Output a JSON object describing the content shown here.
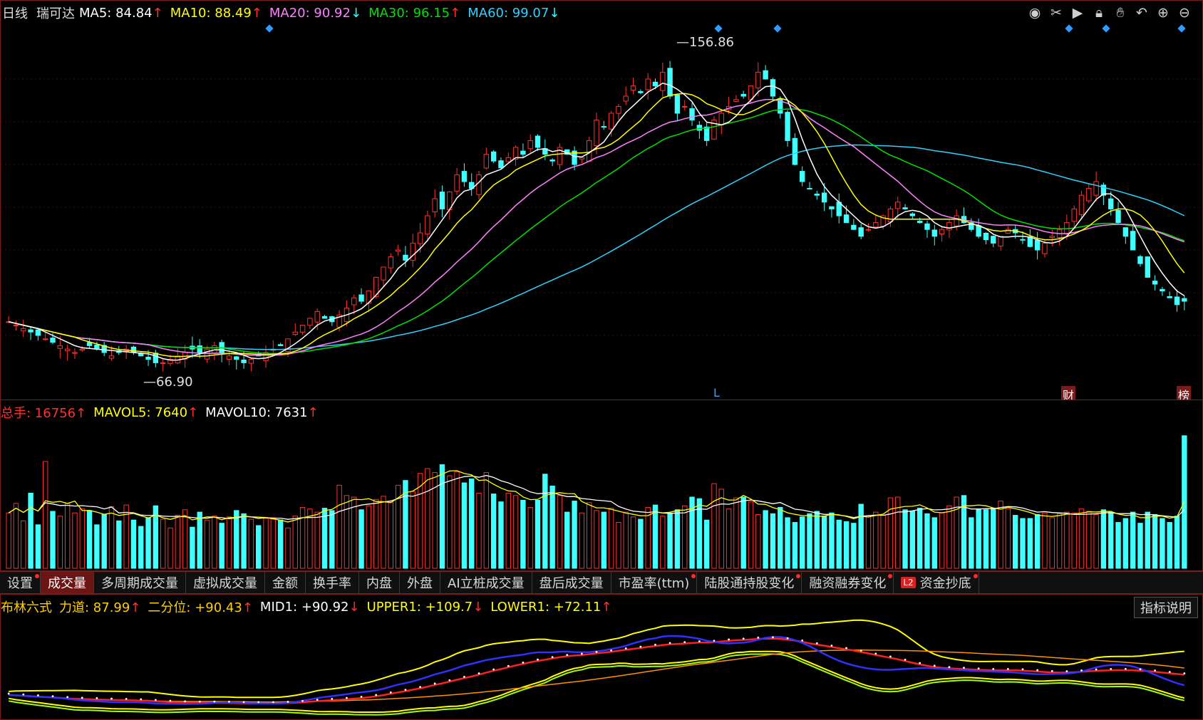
{
  "price_header": {
    "period": "日线",
    "stock": "瑞可达",
    "ma": [
      {
        "label": "MA5: 84.84",
        "arrow": "↑",
        "color": "#ffffff",
        "arrow_color": "#ff3030"
      },
      {
        "label": "MA10: 88.49",
        "arrow": "↑",
        "color": "#ffff00",
        "arrow_color": "#ff3030"
      },
      {
        "label": "MA20: 90.92",
        "arrow": "↓",
        "color": "#ff80ff",
        "arrow_color": "#20ffff"
      },
      {
        "label": "MA30: 96.15",
        "arrow": "↑",
        "color": "#00e000",
        "arrow_color": "#ff3030"
      },
      {
        "label": "MA60: 99.07",
        "arrow": "↓",
        "color": "#30d0ff",
        "arrow_color": "#20ffff"
      }
    ]
  },
  "toolbar_icons": [
    "eye-icon",
    "scissors-icon",
    "play-icon",
    "lock-icon",
    "hand-icon",
    "undo-icon",
    "zoom-in-icon",
    "zoom-out-icon"
  ],
  "price_labels": {
    "high": "156.86",
    "low": "66.90"
  },
  "markers": {
    "l_mark": "L",
    "finance_mark": "财",
    "rank_mark": "榜"
  },
  "volume_header": {
    "items": [
      {
        "label": "总手: 16756",
        "arrow": "↑",
        "color": "#ff3030"
      },
      {
        "label": "MAVOL5: 7640",
        "arrow": "↑",
        "color": "#ffff00"
      },
      {
        "label": "MAVOL10: 7631",
        "arrow": "↑",
        "color": "#ffffff"
      }
    ]
  },
  "tabs": [
    {
      "label": "设置",
      "dot": true,
      "active": false
    },
    {
      "label": "成交量",
      "dot": false,
      "active": true
    },
    {
      "label": "多周期成交量",
      "dot": false,
      "active": false
    },
    {
      "label": "虚拟成交量",
      "dot": false,
      "active": false
    },
    {
      "label": "金额",
      "dot": false,
      "active": false
    },
    {
      "label": "换手率",
      "dot": false,
      "active": false
    },
    {
      "label": "内盘",
      "dot": false,
      "active": false
    },
    {
      "label": "外盘",
      "dot": false,
      "active": false
    },
    {
      "label": "AI立桩成交量",
      "dot": false,
      "active": false
    },
    {
      "label": "盘后成交量",
      "dot": false,
      "active": false
    },
    {
      "label": "市盈率(ttm)",
      "dot": true,
      "active": false
    },
    {
      "label": "陆股通持股变化",
      "dot": true,
      "active": false
    },
    {
      "label": "融资融券变化",
      "dot": true,
      "active": false
    },
    {
      "label": "资金抄底",
      "dot": true,
      "active": false,
      "badge": "L2"
    }
  ],
  "indicator_header": {
    "items": [
      {
        "label": "布林六式",
        "arrow": "",
        "color": "#ffd000"
      },
      {
        "label": "力道: 87.99",
        "arrow": "↑",
        "color": "#ffd000"
      },
      {
        "label": "二分位: +90.43",
        "arrow": "↑",
        "color": "#ffd000"
      },
      {
        "label": "MID1: +90.92",
        "arrow": "↓",
        "color": "#ffffff"
      },
      {
        "label": "UPPER1: +109.7",
        "arrow": "↓",
        "color": "#ffff00"
      },
      {
        "label": "LOWER1: +72.11",
        "arrow": "↑",
        "color": "#ffff00"
      }
    ],
    "help_label": "指标说明"
  },
  "chart_data": {
    "type": "candlestick",
    "series_colors": {
      "up": "#ff3030",
      "down": "#40ffff",
      "ma5": "#ffffff",
      "ma10": "#ffff00",
      "ma20": "#ff80ff",
      "ma30": "#00e000",
      "ma60": "#30d0ff"
    },
    "y_range": [
      60,
      165
    ],
    "close": [
      79,
      78,
      77,
      76,
      75,
      74,
      73,
      72,
      71,
      70,
      71,
      72,
      71,
      70,
      69,
      70,
      71,
      70,
      69,
      68,
      67,
      67,
      68,
      69,
      70,
      71,
      70,
      71,
      72,
      70,
      69,
      68,
      67,
      68,
      69,
      70,
      71,
      72,
      74,
      76,
      78,
      80,
      82,
      80,
      79,
      81,
      83,
      86,
      85,
      88,
      92,
      95,
      98,
      100,
      97,
      102,
      105,
      110,
      115,
      112,
      117,
      122,
      120,
      118,
      122,
      128,
      126,
      124,
      127,
      130,
      128,
      132,
      130,
      128,
      126,
      130,
      128,
      125,
      127,
      132,
      138,
      136,
      140,
      142,
      145,
      148,
      146,
      150,
      148,
      152,
      145,
      140,
      142,
      138,
      135,
      132,
      138,
      140,
      142,
      144,
      145,
      148,
      152,
      150,
      145,
      140,
      132,
      125,
      120,
      118,
      116,
      114,
      112,
      110,
      108,
      106,
      104,
      106,
      108,
      110,
      112,
      114,
      112,
      110,
      108,
      106,
      104,
      106,
      108,
      110,
      108,
      106,
      104,
      103,
      102,
      104,
      106,
      105,
      103,
      101,
      100,
      102,
      104,
      106,
      108,
      112,
      116,
      118,
      120,
      116,
      112,
      108,
      104,
      100,
      96,
      92,
      90,
      88,
      86,
      84,
      85
    ],
    "volume": [
      7000,
      8200,
      6000,
      9500,
      5500,
      13500,
      7200,
      6600,
      8200,
      7000,
      7500,
      7300,
      5500,
      6800,
      7800,
      6000,
      8000,
      6100,
      5300,
      6400,
      7900,
      6200,
      5100,
      6700,
      7400,
      5200,
      7100,
      6100,
      6600,
      5700,
      6500,
      7300,
      6900,
      6200,
      5400,
      6300,
      6400,
      6100,
      5100,
      6600,
      7700,
      7500,
      7100,
      7600,
      7300,
      10500,
      9200,
      9000,
      7400,
      7900,
      8700,
      9100,
      8400,
      10500,
      11100,
      9700,
      12000,
      12600,
      12100,
      13100,
      11700,
      12200,
      10800,
      11300,
      9500,
      12100,
      9400,
      8400,
      9500,
      9200,
      8600,
      7700,
      8600,
      11900,
      10400,
      9200,
      7100,
      8500,
      7000,
      8300,
      7300,
      7100,
      7600,
      5800,
      7100,
      6500,
      6200,
      7700,
      8000,
      6600,
      6900,
      7400,
      7900,
      9000,
      8800,
      6100,
      10700,
      10000,
      7500,
      8900,
      9000,
      8400,
      6800,
      7300,
      6900,
      7700,
      6400,
      5800,
      6500,
      6900,
      7200,
      6600,
      7000,
      6100,
      5900,
      5700,
      8100,
      6600,
      7100,
      6700,
      8900,
      9000,
      7400,
      7200,
      7600,
      6900,
      6400,
      7000,
      7900,
      9000,
      9200,
      6400,
      7500,
      7400,
      7600,
      8500,
      7500,
      6700,
      6300,
      6300,
      6800,
      7000,
      6400,
      6900,
      7100,
      7000,
      7500,
      7200,
      6800,
      7400,
      7100,
      5800,
      6300,
      7100,
      5700,
      7100,
      6800,
      6300,
      5800,
      6600,
      16756
    ]
  }
}
